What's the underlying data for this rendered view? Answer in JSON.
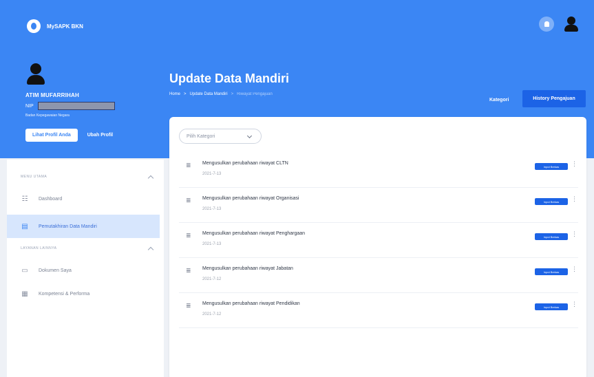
{
  "header": {
    "app_name": "MySAPK BKN"
  },
  "profile": {
    "name": "ATIM MUFARRIHAH",
    "nip_label": "NIP",
    "agency": "Badan Kepegawaian Negara",
    "view_profile_label": "Lihat Profil Anda",
    "edit_profile_label": "Ubah Profil"
  },
  "sidebar": {
    "section_main": "MENU UTAMA",
    "section_services": "LAYANAN LAINNYA",
    "items": [
      {
        "label": "Dashboard",
        "icon": "dashboard-icon"
      },
      {
        "label": "Pemutakhiran Data Mandiri",
        "icon": "document-icon"
      },
      {
        "label": "Dokumen Saya",
        "icon": "folder-icon"
      },
      {
        "label": "Kompetensi & Performa",
        "icon": "performance-icon"
      }
    ]
  },
  "page": {
    "title": "Update Data Mandiri",
    "breadcrumb": [
      "Home",
      ">",
      "Update Data Mandiri",
      ">",
      "Riwayat Pengajuan"
    ],
    "kategori_label": "Kategori",
    "history_button": "History Pengajuan"
  },
  "filter": {
    "placeholder": "Pilih Kategori"
  },
  "requests": [
    {
      "title": "Mengusulkan perubahaan riwayat CLTN",
      "date": "2021-7-13",
      "status": "Input Berkas"
    },
    {
      "title": "Mengusulkan perubahaan riwayat Organisasi",
      "date": "2021-7-13",
      "status": "Input Berkas"
    },
    {
      "title": "Mengusulkan perubahaan riwayat Penghargaan",
      "date": "2021-7-13",
      "status": "Input Berkas"
    },
    {
      "title": "Mengusulkan perubahaan riwayat Jabatan",
      "date": "2021-7-12",
      "status": "Input Berkas"
    },
    {
      "title": "Mengusulkan perubahaan riwayat Pendidikan",
      "date": "2021-7-12",
      "status": "Input Berkas"
    }
  ],
  "colors": {
    "primary": "#3b86f4",
    "button_dark": "#1c63e6",
    "active_bg": "#d7e6fd"
  }
}
